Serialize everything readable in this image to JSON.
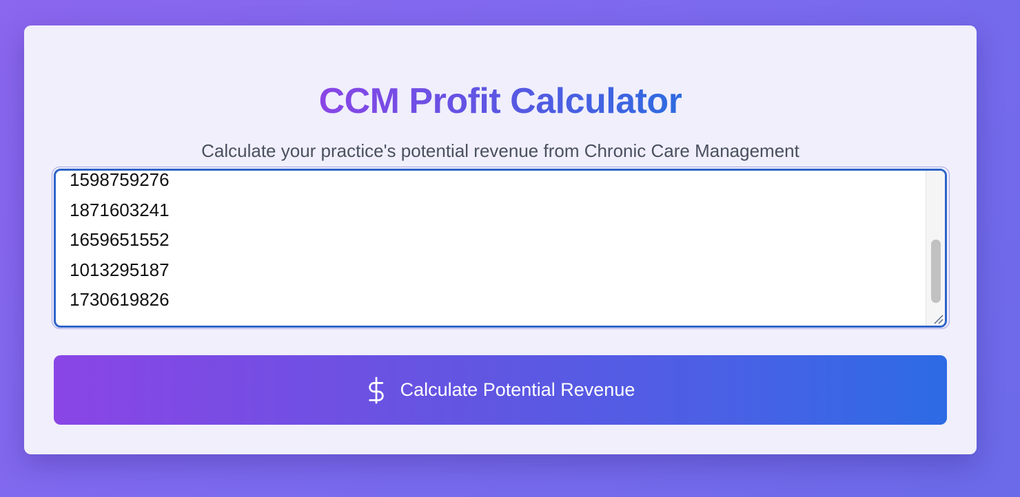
{
  "header": {
    "title": "CCM Profit Calculator",
    "subtitle": "Calculate your practice's potential revenue from Chronic Care Management"
  },
  "npi_input": {
    "visible_lines": [
      "1598759276",
      "1871603241",
      "1659651552",
      "1013295187",
      "1730619826"
    ]
  },
  "action": {
    "label": "Calculate Potential Revenue",
    "icon": "dollar-sign-icon"
  },
  "colors": {
    "gradient_start": "#8a45e6",
    "gradient_end": "#2d6be5",
    "focus_border": "#2f63c9",
    "card_background": "#f0effb"
  }
}
